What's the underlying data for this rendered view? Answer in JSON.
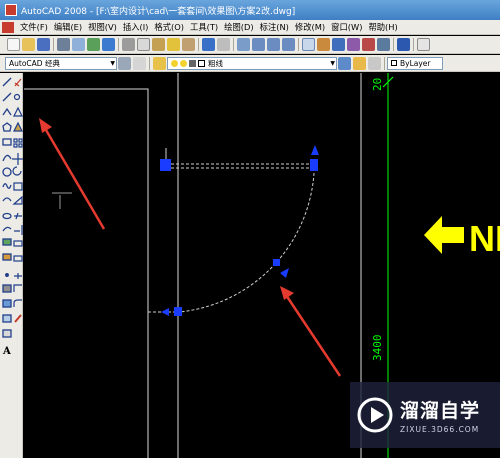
{
  "window": {
    "title": "AutoCAD 2008 - [F:\\室内设计\\cad\\一套套间\\效果图\\方案2改.dwg]"
  },
  "menubar": {
    "items": [
      "文件(F)",
      "编辑(E)",
      "视图(V)",
      "插入(I)",
      "格式(O)",
      "工具(T)",
      "绘图(D)",
      "标注(N)",
      "修改(M)",
      "窗口(W)",
      "帮助(H)"
    ]
  },
  "toolbar2": {
    "workspace": "AutoCAD 经典",
    "layer": "粗线",
    "color": "ByLayer"
  },
  "drawing": {
    "dimension_top": "20",
    "dimension_side": "3400",
    "arrow_text": "NI",
    "colors": {
      "background": "#000000",
      "dimension": "#00ff00",
      "grip": "#1a3cff",
      "arrow": "#ffff00",
      "annotation": "#e53a2f"
    }
  },
  "watermark": {
    "name": "溜溜自学",
    "url": "ZIXUE.3D66.COM"
  }
}
